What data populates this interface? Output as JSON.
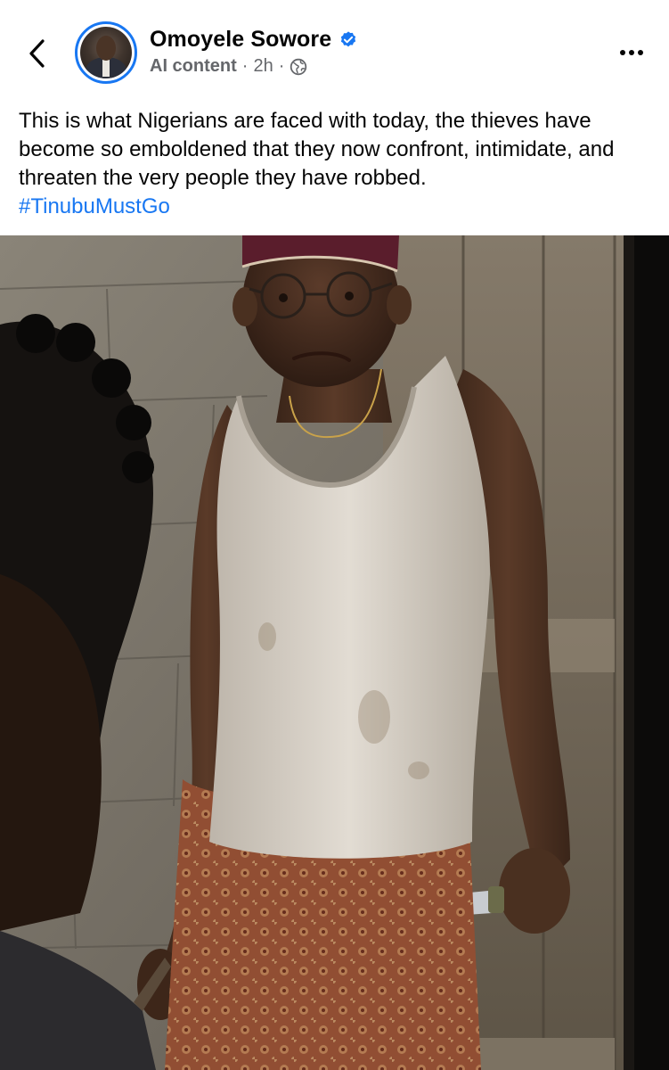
{
  "header": {
    "back_icon": "chevron-left-icon",
    "author_name": "Omoyele Sowore",
    "verified_icon": "verified-badge-icon",
    "label": "AI content",
    "separator": "·",
    "time": "2h",
    "separator2": "·",
    "audience_icon": "globe-icon",
    "more_icon": "more-horizontal-icon"
  },
  "post": {
    "text": "This is what Nigerians are faced with today, the thieves have become so emboldened that they now confront, intimidate, and threaten the very people they have robbed.",
    "hashtag": "#TinubuMustGo"
  },
  "colors": {
    "accent": "#1877f2",
    "muted_text": "#65676b",
    "text": "#050505"
  }
}
